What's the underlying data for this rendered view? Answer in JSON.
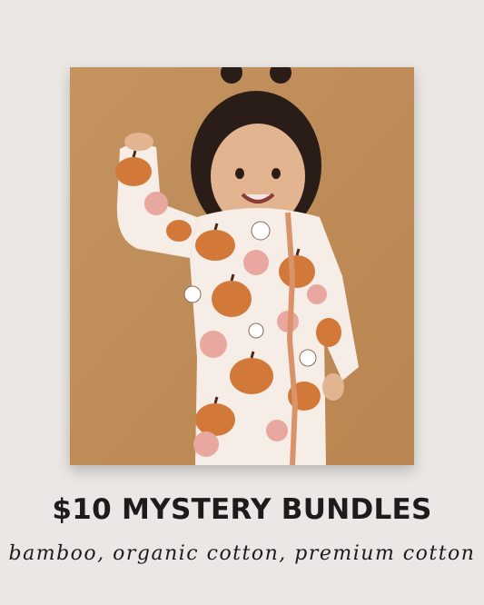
{
  "headline": "$10 MYSTERY BUNDLES",
  "tagline": "bamboo, organic cotton, premium cotton",
  "colors": {
    "background": "#ebe7e4",
    "photo_backdrop": "#c08e5a",
    "text": "#1d1b1b",
    "pumpkin": "#d2793a",
    "flower": "#e8a8a0",
    "fabric": "#f6ede6"
  }
}
